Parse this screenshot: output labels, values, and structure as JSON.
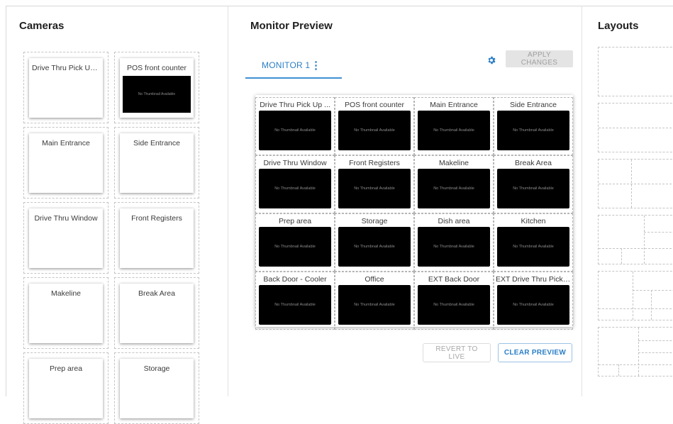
{
  "cameras": {
    "title": "Cameras",
    "items": [
      {
        "name": "Drive Thru Pick Up ...",
        "thumbnail": false
      },
      {
        "name": "POS front counter",
        "thumbnail": true,
        "thumb_text": "No Thumbnail Available"
      },
      {
        "name": "Main Entrance",
        "thumbnail": false
      },
      {
        "name": "Side Entrance",
        "thumbnail": false
      },
      {
        "name": "Drive Thru Window",
        "thumbnail": false
      },
      {
        "name": "Front Registers",
        "thumbnail": false
      },
      {
        "name": "Makeline",
        "thumbnail": false
      },
      {
        "name": "Break Area",
        "thumbnail": false
      },
      {
        "name": "Prep area",
        "thumbnail": false
      },
      {
        "name": "Storage",
        "thumbnail": false
      }
    ]
  },
  "monitor": {
    "title": "Monitor Preview",
    "tab_label": "MONITOR 1",
    "tab_menu_icon": "more-vert-icon",
    "settings_icon": "gear-icon",
    "apply_label": "APPLY CHANGES",
    "thumb_text": "No Thumbnail Available",
    "grid": [
      "Drive Thru Pick Up ...",
      "POS front counter",
      "Main Entrance",
      "Side Entrance",
      "Drive Thru Window",
      "Front Registers",
      "Makeline",
      "Break Area",
      "Prep area",
      "Storage",
      "Dish area",
      "Kitchen",
      "Back Door - Cooler",
      "Office",
      "EXT Back Door",
      "EXT Drive Thru Pick ..."
    ],
    "revert_label": "REVERT TO LIVE",
    "clear_label": "CLEAR PREVIEW"
  },
  "layouts": {
    "title": "Layouts",
    "items": [
      "layout-1x1",
      "layout-1x2",
      "layout-2x2",
      "layout-1-plus-5",
      "layout-1-plus-7",
      "layout-1-plus-9"
    ]
  },
  "colors": {
    "accent": "#2b7fc6",
    "thumb_bg": "#000000",
    "disabled_bg": "#e4e4e4"
  }
}
